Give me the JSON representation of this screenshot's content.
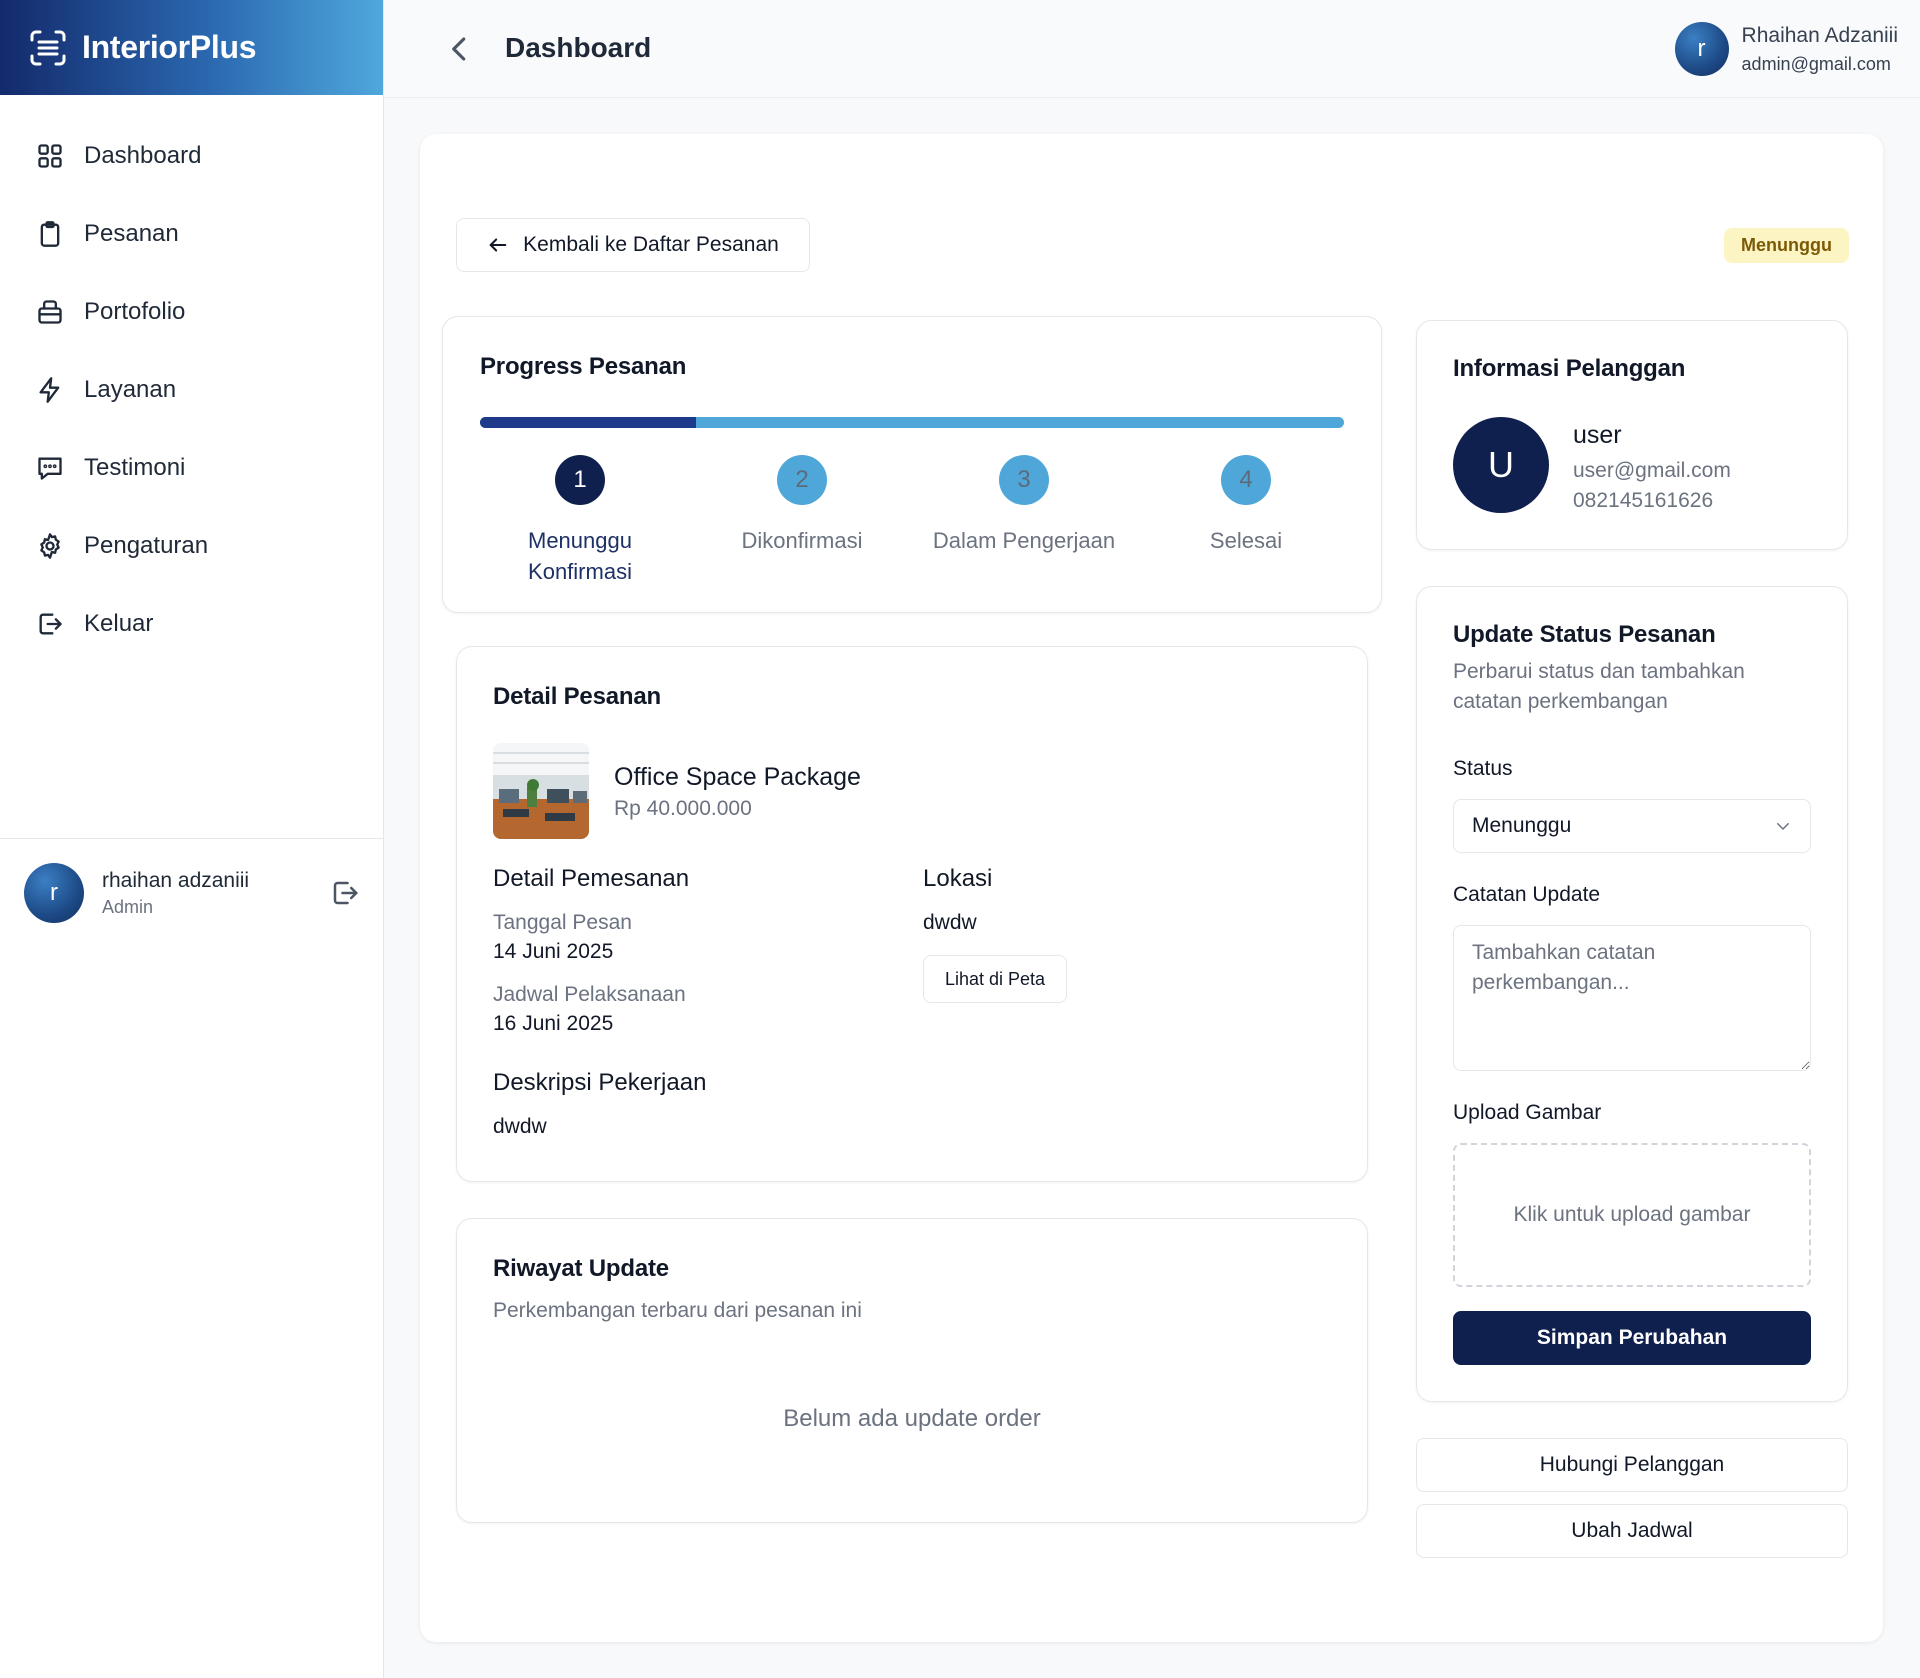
{
  "brand": {
    "name": "InteriorPlus"
  },
  "sidebar": {
    "items": [
      {
        "label": "Dashboard",
        "icon": "grid-icon"
      },
      {
        "label": "Pesanan",
        "icon": "clipboard-icon"
      },
      {
        "label": "Portofolio",
        "icon": "briefcase-icon"
      },
      {
        "label": "Layanan",
        "icon": "lightning-icon"
      },
      {
        "label": "Testimoni",
        "icon": "message-icon"
      },
      {
        "label": "Pengaturan",
        "icon": "gear-icon"
      },
      {
        "label": "Keluar",
        "icon": "logout-icon"
      }
    ],
    "user": {
      "initial": "r",
      "name": "rhaihan adzaniii",
      "role": "Admin"
    }
  },
  "header": {
    "title": "Dashboard",
    "user": {
      "initial": "r",
      "name": "Rhaihan Adzaniii",
      "email": "admin@gmail.com"
    }
  },
  "order": {
    "back_label": "Kembali ke Daftar Pesanan",
    "status_badge": "Menunggu",
    "colors": {
      "primary": "#0f1f4e",
      "accent": "#4fa6d9",
      "badge_bg": "#fdf4c4"
    },
    "progress": {
      "title": "Progress Pesanan",
      "completed_fraction": 0.25,
      "steps": [
        {
          "number": "1",
          "label": "Menunggu Konfirmasi",
          "state": "active"
        },
        {
          "number": "2",
          "label": "Dikonfirmasi",
          "state": "todo"
        },
        {
          "number": "3",
          "label": "Dalam Pengerjaan",
          "state": "todo"
        },
        {
          "number": "4",
          "label": "Selesai",
          "state": "todo"
        }
      ]
    },
    "detail": {
      "title": "Detail Pesanan",
      "package_name": "Office Space Package",
      "package_price": "Rp 40.000.000",
      "booking_heading": "Detail Pemesanan",
      "order_date_label": "Tanggal Pesan",
      "order_date": "14 Juni 2025",
      "schedule_label": "Jadwal Pelaksanaan",
      "schedule_date": "16 Juni 2025",
      "location_heading": "Lokasi",
      "location": "dwdw",
      "map_button": "Lihat di Peta",
      "description_heading": "Deskripsi Pekerjaan",
      "description": "dwdw"
    },
    "history": {
      "title": "Riwayat Update",
      "subtitle": "Perkembangan terbaru dari pesanan ini",
      "empty": "Belum ada update order"
    }
  },
  "customer": {
    "title": "Informasi Pelanggan",
    "initial": "U",
    "name": "user",
    "email": "user@gmail.com",
    "phone": "082145161626"
  },
  "update_form": {
    "title": "Update Status Pesanan",
    "subtitle": "Perbarui status dan tambahkan catatan perkembangan",
    "status_label": "Status",
    "status_value": "Menunggu",
    "notes_label": "Catatan Update",
    "notes_placeholder": "Tambahkan catatan perkembangan...",
    "upload_label": "Upload Gambar",
    "upload_hint": "Klik untuk upload gambar",
    "save_label": "Simpan Perubahan"
  },
  "actions": {
    "contact_label": "Hubungi Pelanggan",
    "reschedule_label": "Ubah Jadwal"
  }
}
